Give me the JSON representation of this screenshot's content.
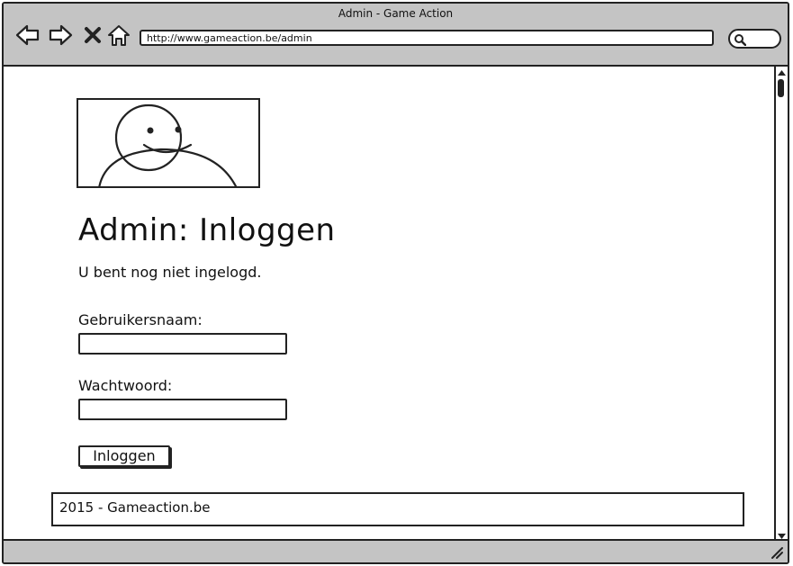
{
  "window": {
    "title": "Admin - Game Action"
  },
  "browser": {
    "address": "http://www.gameaction.be/admin"
  },
  "page": {
    "heading": "Admin: Inloggen",
    "notice": "U bent nog niet ingelogd.",
    "username": {
      "label": "Gebruikersnaam:",
      "value": ""
    },
    "password": {
      "label": "Wachtwoord:",
      "value": ""
    },
    "submit_label": "Inloggen",
    "footer_text": "2015 - Gameaction.be"
  }
}
